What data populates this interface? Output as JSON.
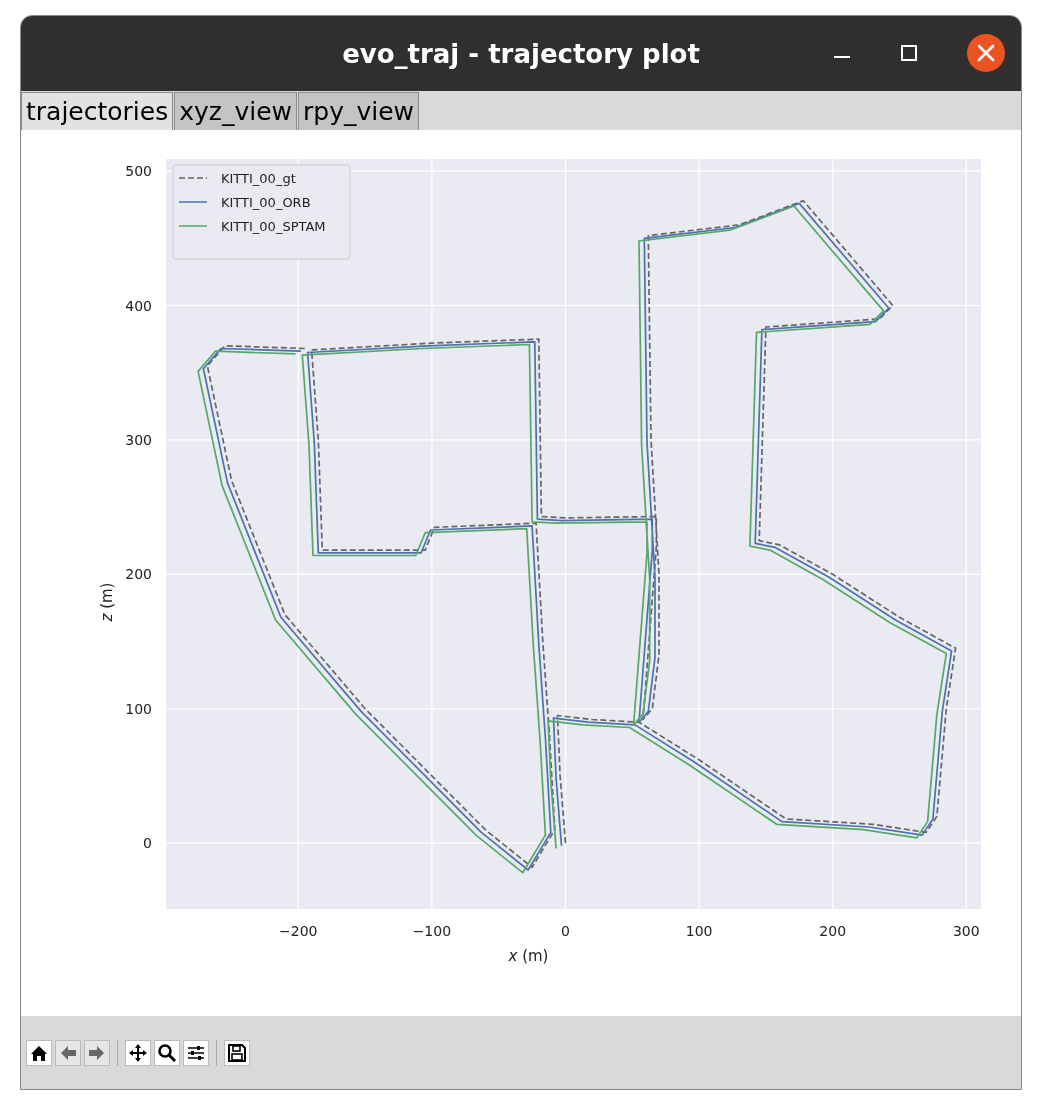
{
  "window": {
    "title": "evo_traj - trajectory plot"
  },
  "tabs": [
    {
      "label": "trajectories",
      "selected": true
    },
    {
      "label": "xyz_view",
      "selected": false
    },
    {
      "label": "rpy_view",
      "selected": false
    }
  ],
  "plot": {
    "chart_data": {
      "type": "line",
      "xlabel": "*x* (m)",
      "ylabel": "*z* (m)",
      "xlim": [
        -299,
        311
      ],
      "ylim": [
        -49,
        509
      ],
      "grid": true,
      "legend": "upper left",
      "xticks": [
        {
          "value": -200,
          "label": "−200"
        },
        {
          "value": -100,
          "label": "−100"
        },
        {
          "value": 0,
          "label": "0"
        },
        {
          "value": 100,
          "label": "100"
        },
        {
          "value": 200,
          "label": "200"
        },
        {
          "value": 300,
          "label": "300"
        }
      ],
      "yticks": [
        {
          "value": 0,
          "label": "0"
        },
        {
          "value": 100,
          "label": "100"
        },
        {
          "value": 200,
          "label": "200"
        },
        {
          "value": 300,
          "label": "300"
        },
        {
          "value": 400,
          "label": "400"
        },
        {
          "value": 500,
          "label": "500"
        }
      ],
      "series": [
        {
          "name": "KITTI_00_gt",
          "color": "#666666",
          "line_style": "dashed",
          "x": [
            0,
            -4,
            -6,
            20,
            55,
            100,
            165,
            230,
            270,
            278,
            285,
            292,
            250,
            200,
            160,
            145,
            150,
            235,
            245,
            178,
            130,
            62,
            64,
            70,
            70,
            65,
            58,
            68,
            68,
            0,
            -18,
            -20,
            -100,
            -190,
            -185,
            -182,
            -105,
            -98,
            -22,
            -17,
            -12,
            -8,
            -25,
            -60,
            -150,
            -210,
            -250,
            -268,
            -255,
            -195
          ],
          "values": [
            0,
            50,
            95,
            92,
            90,
            62,
            18,
            14,
            8,
            20,
            100,
            145,
            168,
            200,
            222,
            225,
            384,
            390,
            400,
            478,
            460,
            452,
            300,
            200,
            140,
            100,
            92,
            220,
            243,
            242,
            243,
            375,
            372,
            367,
            300,
            218,
            218,
            235,
            238,
            150,
            80,
            10,
            -18,
            10,
            100,
            170,
            270,
            355,
            370,
            368
          ]
        },
        {
          "name": "KITTI_00_ORB",
          "color": "#4c72b0",
          "line_style": "solid",
          "x": [
            -3,
            -7,
            -9,
            17,
            52,
            97,
            162,
            227,
            267,
            275,
            282,
            289,
            247,
            197,
            157,
            142,
            147,
            232,
            242,
            175,
            127,
            59,
            61,
            67,
            67,
            62,
            55,
            65,
            65,
            -3,
            -21,
            -23,
            -103,
            -193,
            -188,
            -185,
            -108,
            -101,
            -25,
            -20,
            -15,
            -11,
            -28,
            -63,
            -153,
            -213,
            -253,
            -271,
            -258,
            -198
          ],
          "values": [
            -2,
            48,
            93,
            90,
            88,
            60,
            16,
            12,
            6,
            18,
            98,
            143,
            166,
            198,
            220,
            223,
            382,
            388,
            398,
            476,
            458,
            450,
            298,
            198,
            138,
            98,
            90,
            218,
            241,
            240,
            241,
            373,
            370,
            365,
            298,
            216,
            216,
            233,
            236,
            148,
            78,
            8,
            -20,
            8,
            98,
            168,
            268,
            353,
            368,
            366
          ]
        },
        {
          "name": "KITTI_00_SPTAM",
          "color": "#55a868",
          "line_style": "solid",
          "x": [
            -7,
            -11,
            -13,
            13,
            48,
            93,
            158,
            223,
            263,
            271,
            278,
            285,
            243,
            193,
            153,
            138,
            143,
            228,
            238,
            171,
            123,
            55,
            57,
            63,
            63,
            58,
            51,
            61,
            61,
            -7,
            -25,
            -27,
            -107,
            -197,
            -192,
            -189,
            -112,
            -105,
            -29,
            -24,
            -19,
            -15,
            -32,
            -67,
            -157,
            -217,
            -257,
            -275,
            -262,
            -202
          ],
          "values": [
            -4,
            46,
            91,
            88,
            86,
            58,
            14,
            10,
            4,
            16,
            96,
            141,
            164,
            196,
            218,
            221,
            380,
            386,
            396,
            474,
            456,
            448,
            296,
            196,
            136,
            96,
            88,
            216,
            239,
            238,
            239,
            371,
            368,
            363,
            296,
            214,
            214,
            231,
            234,
            146,
            76,
            6,
            -22,
            6,
            96,
            166,
            266,
            351,
            366,
            364
          ]
        }
      ]
    }
  },
  "toolbar": {
    "groups": [
      [
        {
          "kind": "home",
          "disabled": false
        },
        {
          "kind": "back",
          "disabled": true
        },
        {
          "kind": "forward",
          "disabled": true
        }
      ],
      [
        {
          "kind": "pan",
          "disabled": false
        },
        {
          "kind": "zoom",
          "disabled": false
        },
        {
          "kind": "configure",
          "disabled": false
        }
      ],
      [
        {
          "kind": "save",
          "disabled": false
        }
      ]
    ]
  }
}
